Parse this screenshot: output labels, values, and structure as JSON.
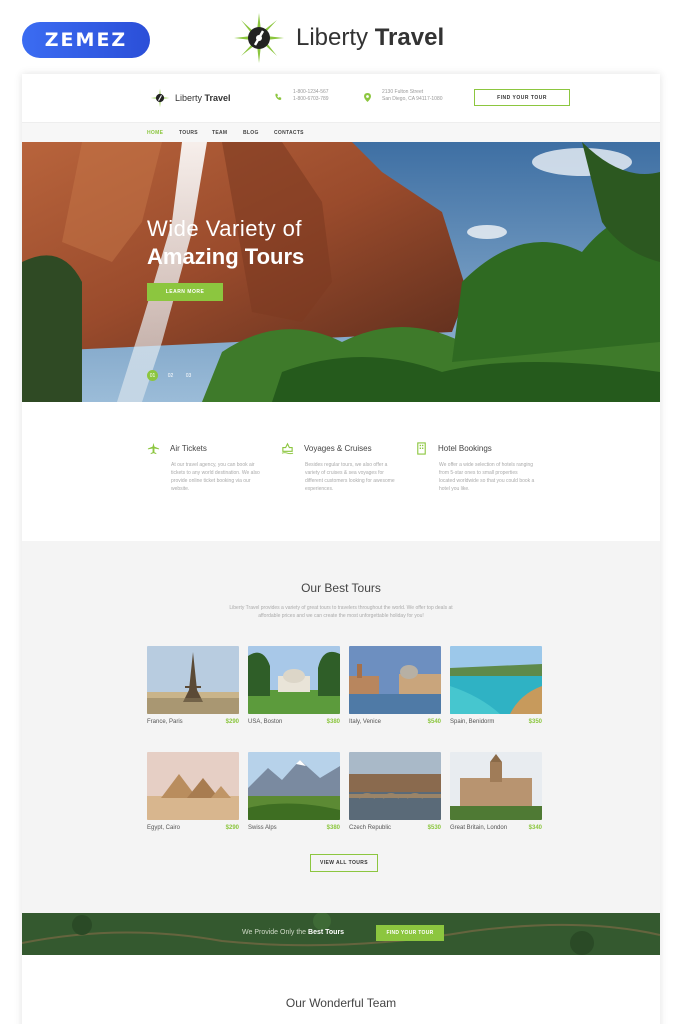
{
  "marketing": {
    "zemez_logo": "ZEMEZ",
    "brand_name_light": "Liberty",
    "brand_name_bold": "Travel"
  },
  "header": {
    "logo_light": "Liberty",
    "logo_bold": "Travel",
    "phone_line1": "1-800-1234-567",
    "phone_line2": "1-800-6703-789",
    "address_line1": "2130 Fulton Street",
    "address_line2": "San Diego, CA 94117-1080",
    "find_tour_label": "FIND YOUR TOUR",
    "phone_icon": "phone-icon",
    "location_icon": "location-pin-icon"
  },
  "nav": {
    "items": [
      {
        "label": "HOME",
        "active": true
      },
      {
        "label": "TOURS",
        "active": false
      },
      {
        "label": "TEAM",
        "active": false
      },
      {
        "label": "BLOG",
        "active": false
      },
      {
        "label": "CONTACTS",
        "active": false
      }
    ]
  },
  "hero": {
    "title_line1": "Wide Variety of",
    "title_line2": "Amazing Tours",
    "button_label": "LEARN MORE",
    "pagination": [
      "01",
      "02",
      "03"
    ],
    "active_slide": 0
  },
  "services": [
    {
      "title": "Air Tickets",
      "icon": "airplane-icon",
      "desc": "At our travel agency, you can book air tickets to any world destination. We also provide online ticket booking via our website."
    },
    {
      "title": "Voyages & Cruises",
      "icon": "cruise-ship-icon",
      "desc": "Besides regular tours, we also offer a variety of cruises & sea voyages for different customers looking for awesome experiences."
    },
    {
      "title": "Hotel Bookings",
      "icon": "hotel-icon",
      "desc": "We offer a wide selection of hotels ranging from 5-star ones to small properties located worldwide so that you could book a hotel you like."
    }
  ],
  "tours": {
    "title": "Our Best Tours",
    "desc": "Liberty Travel provides a variety of great tours to travelers throughout the world. We offer top deals at affordable prices and we can create the most unforgettable holiday for you!",
    "view_all_label": "VIEW ALL TOURS",
    "items": [
      {
        "place": "France, Paris",
        "price": "$290"
      },
      {
        "place": "USA, Boston",
        "price": "$380"
      },
      {
        "place": "Italy, Venice",
        "price": "$540"
      },
      {
        "place": "Spain, Benidorm",
        "price": "$350"
      },
      {
        "place": "Egypt, Cairo",
        "price": "$290"
      },
      {
        "place": "Swiss Alps",
        "price": "$380"
      },
      {
        "place": "Czech Republic",
        "price": "$530"
      },
      {
        "place": "Great Britain, London",
        "price": "$340"
      }
    ]
  },
  "banner": {
    "text_prefix": "We Provide Only the ",
    "text_bold": "Best Tours",
    "button_label": "FIND YOUR TOUR"
  },
  "team": {
    "title": "Our Wonderful Team"
  },
  "colors": {
    "accent": "#8cc63f",
    "zemez_blue": "#3b6cf2"
  }
}
